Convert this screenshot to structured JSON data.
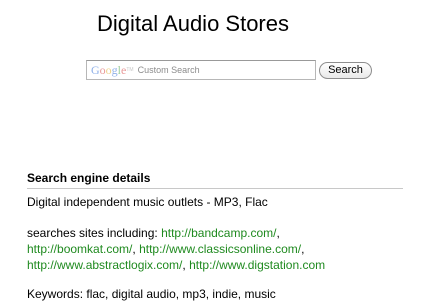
{
  "page": {
    "title": "Digital Audio Stores"
  },
  "search": {
    "logo_letters": [
      "G",
      "o",
      "o",
      "g",
      "l",
      "e"
    ],
    "logo_tm": "TM",
    "placeholder": "Custom Search",
    "button_label": "Search"
  },
  "details": {
    "heading": "Search engine details",
    "description": "Digital independent music outlets - MP3, Flac",
    "sites_prefix": "searches sites including: ",
    "sites": [
      "http://bandcamp.com/",
      "http://boomkat.com/",
      "http://www.classicsonline.com/",
      "http://www.abstractlogix.com/",
      "http://www.digstation.com"
    ],
    "separator": ", ",
    "keywords": "Keywords: flac, digital audio, mp3, indie, music"
  },
  "colors": {
    "link": "#1f8a1f",
    "divider": "#c8c8c8"
  }
}
